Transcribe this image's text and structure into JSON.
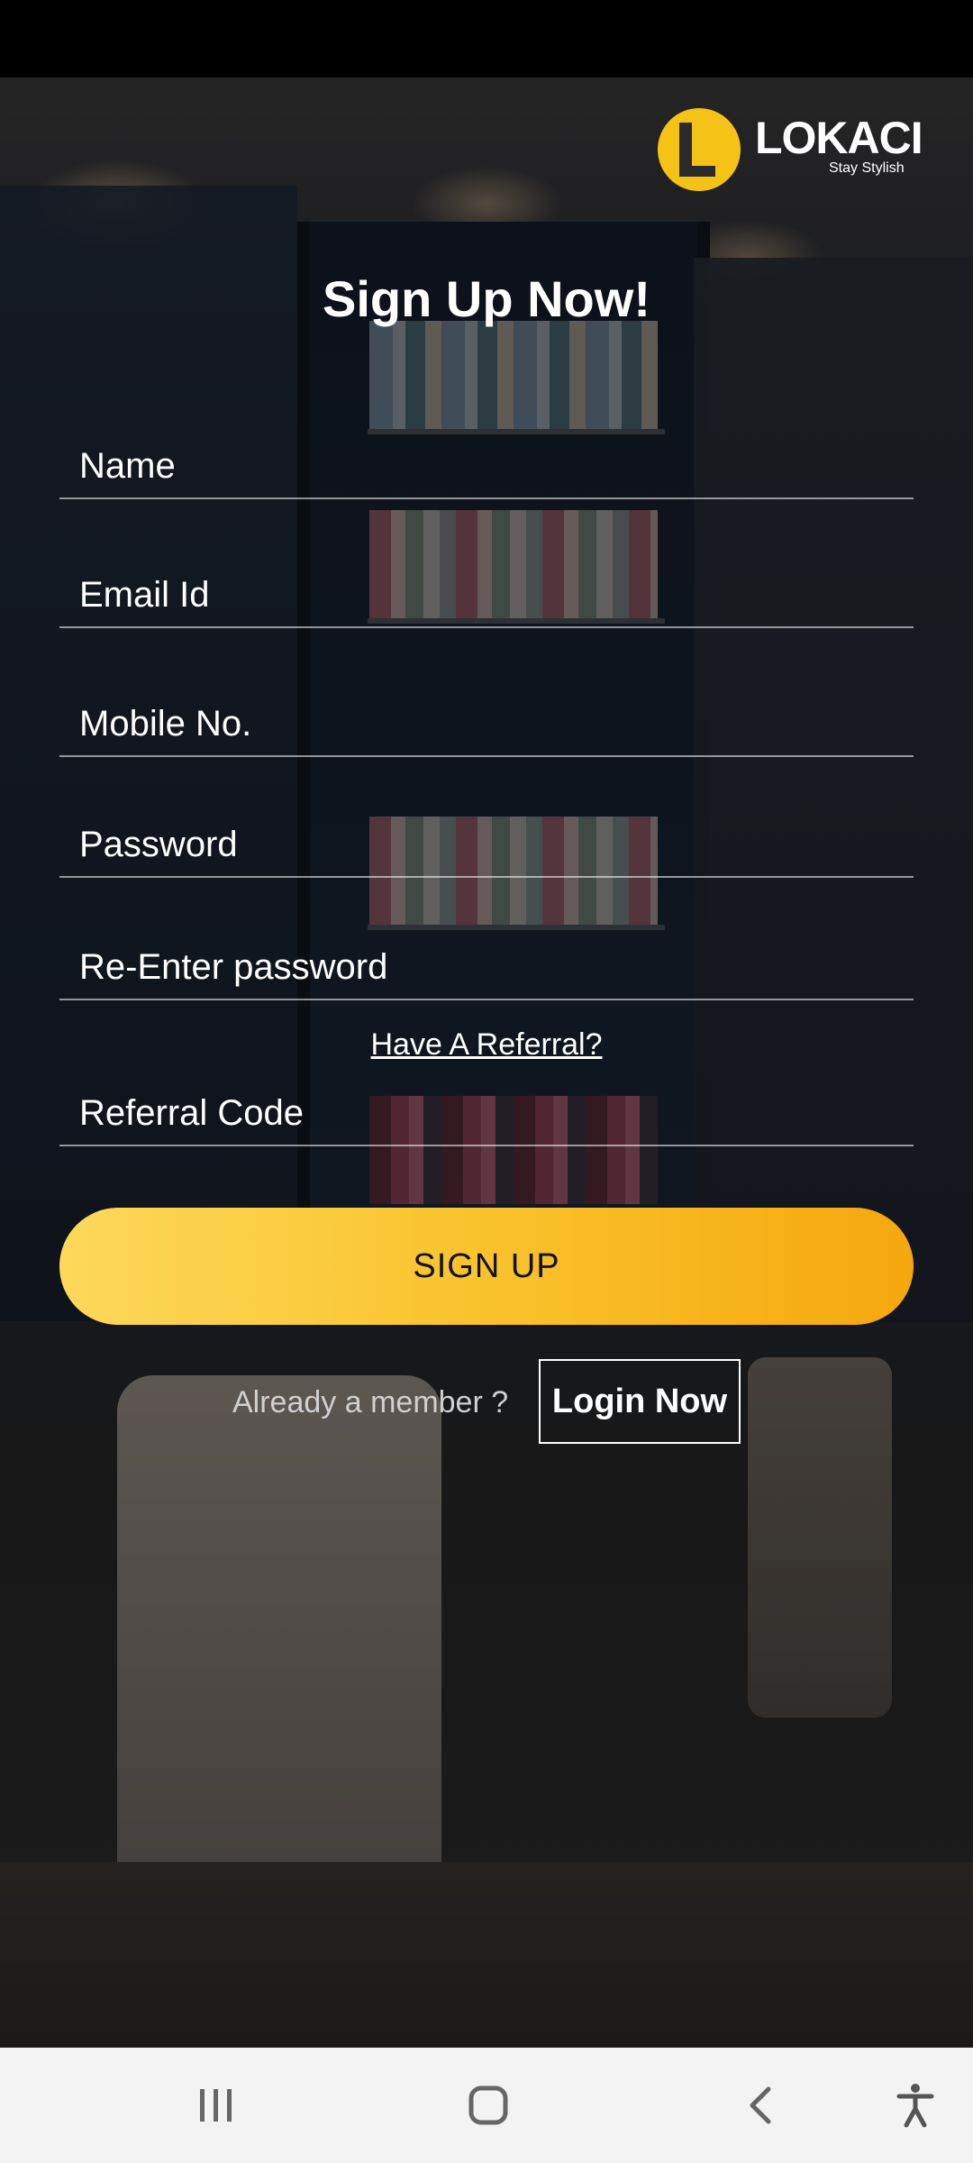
{
  "brand": {
    "name": "LOKACI",
    "tagline": "Stay Stylish",
    "accent_color": "#f5c316"
  },
  "header": {
    "title": "Sign Up Now!"
  },
  "form": {
    "name": {
      "placeholder": "Name",
      "value": ""
    },
    "email": {
      "placeholder": "Email Id",
      "value": ""
    },
    "mobile": {
      "placeholder": "Mobile No.",
      "value": ""
    },
    "password": {
      "placeholder": "Password",
      "value": ""
    },
    "confirm_password": {
      "placeholder": "Re-Enter password",
      "value": ""
    },
    "referral_link": "Have A Referral?",
    "referral_code": {
      "placeholder": "Referral Code",
      "value": ""
    },
    "submit_label": "SIGN UP"
  },
  "footer": {
    "member_text": "Already a member ?",
    "login_label": "Login Now"
  },
  "nav_bar": {
    "icons": [
      "recents-icon",
      "home-icon",
      "back-icon",
      "accessibility-icon"
    ]
  }
}
